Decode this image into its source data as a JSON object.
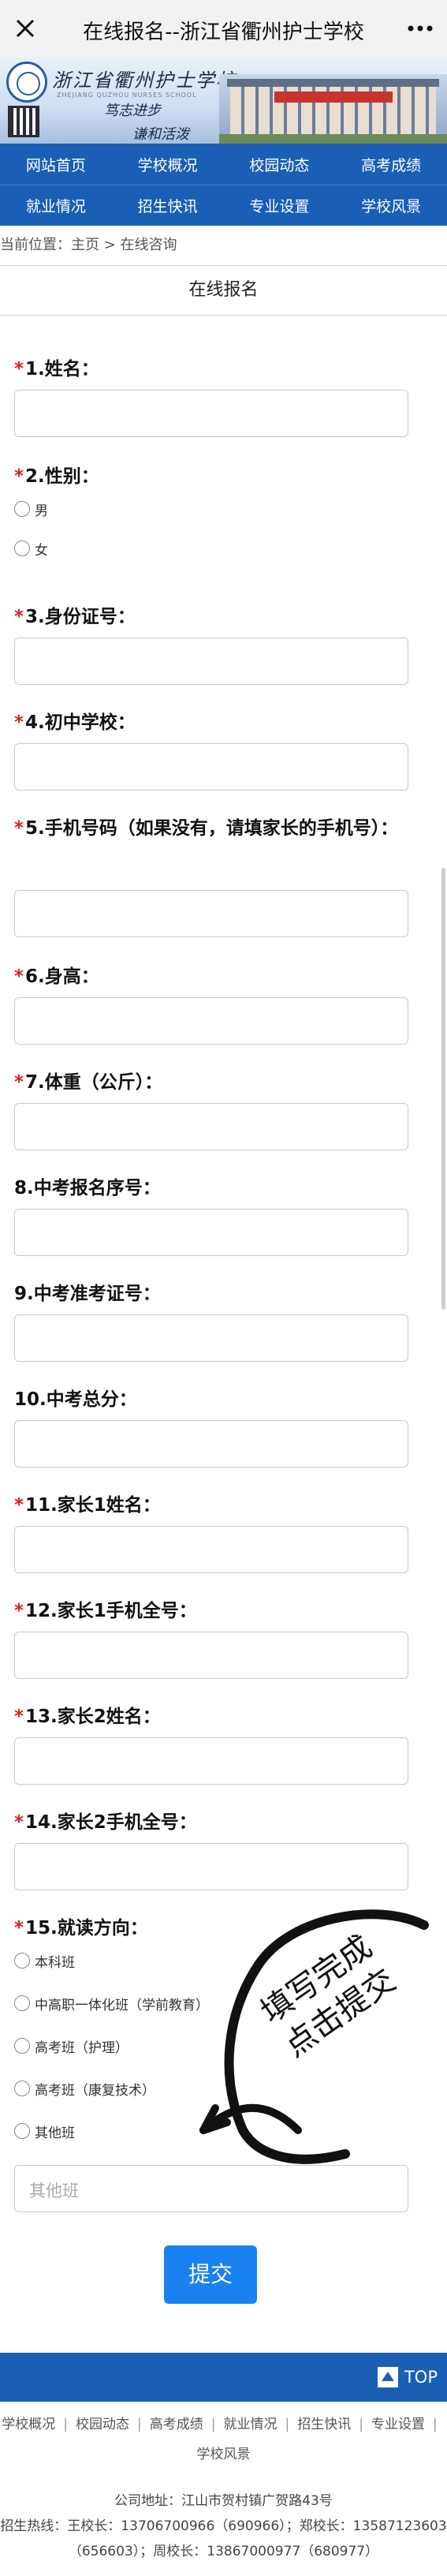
{
  "window": {
    "title": "在线报名--浙江省衢州护士学校"
  },
  "banner": {
    "school_name": "浙江省衢州护士学校",
    "school_name_en": "ZHEJIANG QUZHOU NURSES SCHOOL",
    "motto_1": "笃志进步",
    "motto_2": "谦和活泼"
  },
  "nav": {
    "row1": [
      "网站首页",
      "学校概况",
      "校园动态",
      "高考成绩"
    ],
    "row2": [
      "就业情况",
      "招生快讯",
      "专业设置",
      "学校风景"
    ]
  },
  "breadcrumb": {
    "prefix": "当前位置：",
    "home": "主页",
    "separator": " > ",
    "current": "在线咨询"
  },
  "page_title": "在线报名",
  "form": {
    "fields": [
      {
        "label": "1.姓名：",
        "required": true
      },
      {
        "label": "2.性别：",
        "required": true
      },
      {
        "label": "3.身份证号：",
        "required": true
      },
      {
        "label": "4.初中学校：",
        "required": true
      },
      {
        "label": "5.手机号码（如果没有，请填家长的手机号）：",
        "required": true
      },
      {
        "label": "6.身高：",
        "required": true
      },
      {
        "label": "7.体重（公斤）：",
        "required": true
      },
      {
        "label": "8.中考报名序号：",
        "required": false
      },
      {
        "label": "9.中考准考证号：",
        "required": false
      },
      {
        "label": "10.中考总分：",
        "required": false
      },
      {
        "label": "11.家长1姓名：",
        "required": true
      },
      {
        "label": "12.家长1手机全号：",
        "required": true
      },
      {
        "label": "13.家长2姓名：",
        "required": true
      },
      {
        "label": "14.家长2手机全号：",
        "required": true
      },
      {
        "label": "15.就读方向：",
        "required": true
      }
    ],
    "gender_options": [
      "男",
      "女"
    ],
    "direction_options": [
      "本科班",
      "中高职一体化班（学前教育）",
      "高考班（护理）",
      "高考班（康复技术）",
      "其他班"
    ],
    "other_placeholder": "其他班",
    "required_mark": "*",
    "submit_label": "提交"
  },
  "stamp": {
    "line1": "填写完成",
    "line2": "点击提交"
  },
  "footer": {
    "top_label": "TOP",
    "links": [
      "学校概况",
      "校园动态",
      "高考成绩",
      "就业情况",
      "招生快讯",
      "专业设置",
      "学校风景"
    ],
    "address": "公司地址：江山市贺村镇广贺路43号",
    "hotline": "招生热线：王校长：13706700966（690966）；郑校长：13587123603（656603）；周校长：13867000977（680977）"
  },
  "colors": {
    "nav_blue": "#1a5fb5",
    "submit_blue": "#1a82f0",
    "required_red": "#e02020"
  }
}
